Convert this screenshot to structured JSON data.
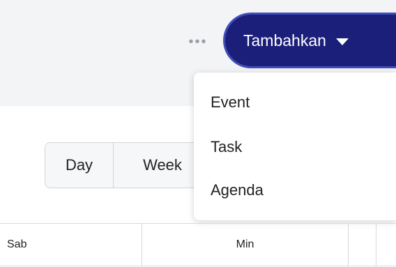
{
  "toolbar": {
    "more_icon": "more-horizontal-icon",
    "more_glyph": "•••",
    "add_button_label": "Tambahkan",
    "add_button_icon": "caret-down-icon",
    "accent_color": "#1b1f7a"
  },
  "add_menu": {
    "items": [
      {
        "label": "Event"
      },
      {
        "label": "Task"
      },
      {
        "label": "Agenda"
      }
    ]
  },
  "views": {
    "day_label": "Day",
    "week_label": "Week"
  },
  "calendar": {
    "columns": [
      "Sab",
      "Min",
      ""
    ]
  }
}
